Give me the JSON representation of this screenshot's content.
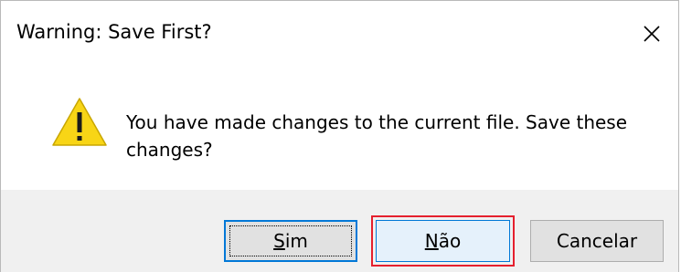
{
  "dialog": {
    "title": "Warning: Save First?",
    "close_icon": "close-icon",
    "icon": "warning-icon",
    "message_line1": "You have made changes to the current file. Save these",
    "message_line2": "changes?",
    "buttons": {
      "yes": {
        "first": "S",
        "rest": "im"
      },
      "no": {
        "first": "N",
        "rest": "ão"
      },
      "cancel": "Cancelar"
    },
    "colors": {
      "warning_fill": "#f8d516",
      "highlight_border": "#e5202e",
      "focus_border": "#0078d7",
      "footer_bg": "#f0f0f0"
    }
  }
}
